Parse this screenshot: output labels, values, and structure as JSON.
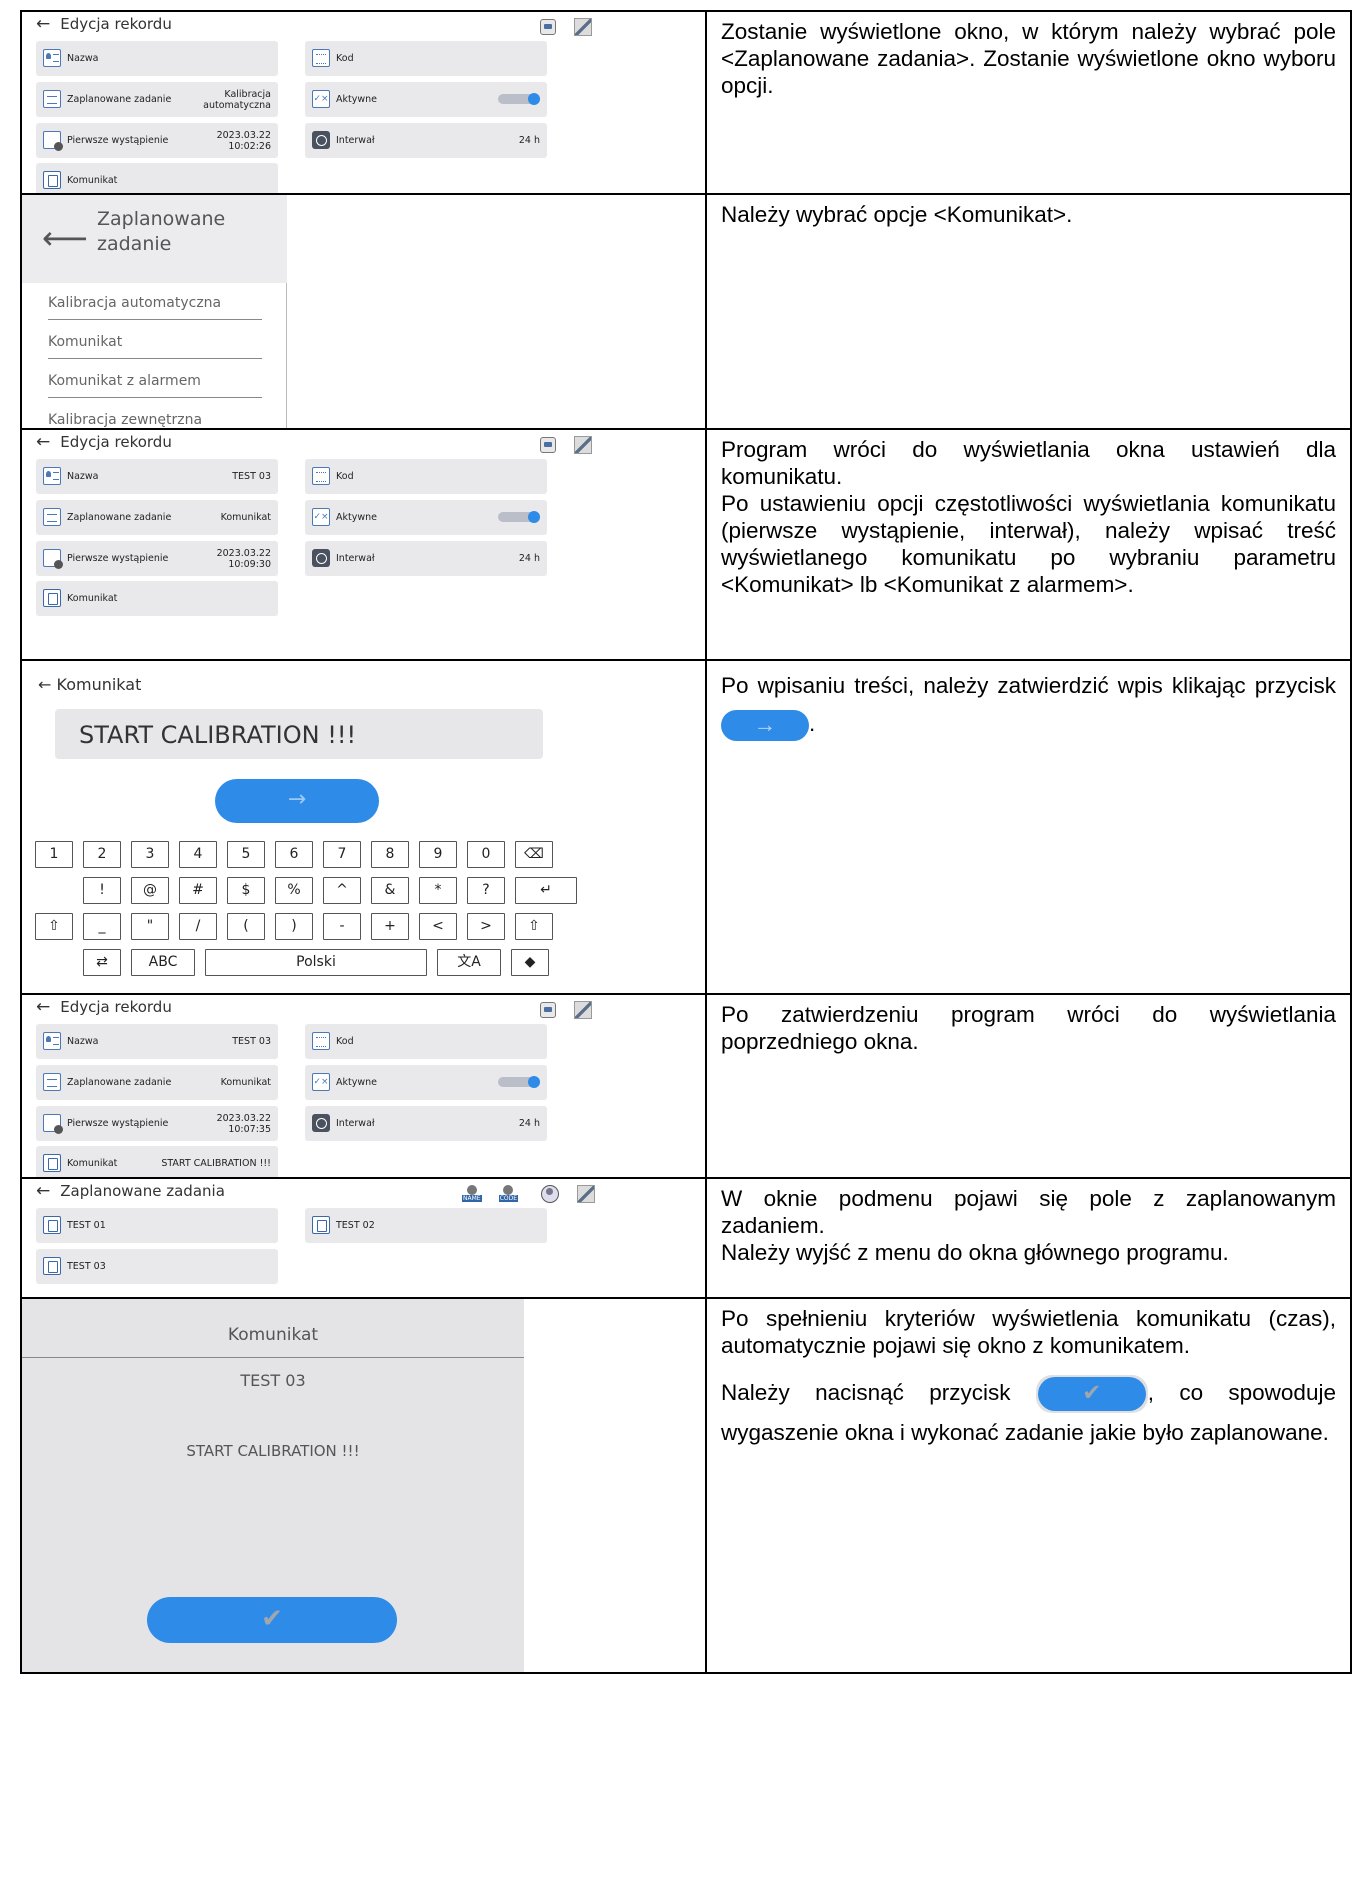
{
  "rows": [
    {
      "screen": {
        "header": "Edycja rekordu",
        "tiles": [
          {
            "label": "Nazwa",
            "value": ""
          },
          {
            "label": "Kod",
            "value": ""
          },
          {
            "label": "Zaplanowane zadanie",
            "value_l1": "Kalibracja",
            "value_l2": "automatyczna"
          },
          {
            "label": "Aktywne"
          },
          {
            "label": "Pierwsze wystąpienie",
            "value_l1": "2023.03.22",
            "value_l2": "10:02:26"
          },
          {
            "label": "Interwał",
            "value": "24 h"
          },
          {
            "label": "Komunikat",
            "value": ""
          }
        ]
      },
      "text": "Zostanie wyświetlone okno, w którym należy wybrać pole <Zaplanowane zadania>. Zostanie wyświetlone okno wyboru opcji."
    },
    {
      "screen": {
        "title_l1": "Zaplanowane",
        "title_l2": "zadanie",
        "options": [
          "Kalibracja automatyczna",
          "Komunikat",
          "Komunikat z alarmem",
          "Kalibracja zewnętrzna"
        ]
      },
      "text": "Należy wybrać opcje <Komunikat>."
    },
    {
      "screen": {
        "header": "Edycja rekordu",
        "tiles": [
          {
            "label": "Nazwa",
            "value": "TEST 03"
          },
          {
            "label": "Kod",
            "value": ""
          },
          {
            "label": "Zaplanowane zadanie",
            "value": "Komunikat"
          },
          {
            "label": "Aktywne"
          },
          {
            "label": "Pierwsze wystąpienie",
            "value_l1": "2023.03.22",
            "value_l2": "10:09:30"
          },
          {
            "label": "Interwał",
            "value": "24 h"
          },
          {
            "label": "Komunikat",
            "value": ""
          }
        ]
      },
      "text_p1": "Program wróci do wyświetlania okna ustawień dla komunikatu.",
      "text_p2": "Po ustawieniu opcji częstotliwości wyświetlania komunikatu (pierwsze wystąpienie, interwał), należy wpisać treść wyświetlanego komunikatu po wybraniu parametru <Komunikat> lb <Komunikat z alarmem>."
    },
    {
      "screen": {
        "header": "Komunikat",
        "input_value": "START CALIBRATION !!!",
        "confirm_icon": "→",
        "keys_row1": [
          "1",
          "2",
          "3",
          "4",
          "5",
          "6",
          "7",
          "8",
          "9",
          "0",
          "⌫"
        ],
        "keys_row2": [
          "!",
          "@",
          "#",
          "$",
          "%",
          "^",
          "&",
          "*",
          "?",
          "↵"
        ],
        "keys_row3": [
          "⇧",
          "_",
          "\"",
          "/",
          "(",
          ")",
          "-",
          "+",
          "<",
          ">",
          "⇧"
        ],
        "keys_row4": [
          "⇄",
          "ABC",
          "Polski",
          "文A",
          "◆"
        ]
      },
      "text_a": "Po wpisaniu treści, należy zatwierdzić wpis klikając przycisk",
      "text_b": "."
    },
    {
      "screen": {
        "header": "Edycja rekordu",
        "tiles": [
          {
            "label": "Nazwa",
            "value": "TEST 03"
          },
          {
            "label": "Kod",
            "value": ""
          },
          {
            "label": "Zaplanowane zadanie",
            "value": "Komunikat"
          },
          {
            "label": "Aktywne"
          },
          {
            "label": "Pierwsze wystąpienie",
            "value_l1": "2023.03.22",
            "value_l2": "10:07:35"
          },
          {
            "label": "Interwał",
            "value": "24 h"
          },
          {
            "label": "Komunikat",
            "value": "START CALIBRATION !!!"
          }
        ]
      },
      "text": "Po zatwierdzeniu program wróci do wyświetlania poprzedniego okna."
    },
    {
      "screen": {
        "header": "Zaplanowane zadania",
        "icon_labels": [
          "NAME",
          "CODE"
        ],
        "tiles": [
          "TEST 01",
          "TEST 02",
          "TEST 03"
        ]
      },
      "text_p1": "W oknie podmenu pojawi się pole z zaplanowanym zadaniem.",
      "text_p2": "Należy wyjść z menu do okna głównego programu."
    },
    {
      "screen": {
        "title": "Komunikat",
        "name": "TEST 03",
        "body": "START CALIBRATION !!!",
        "ok_icon": "✔"
      },
      "text_p1": "Po spełnieniu kryteriów wyświetlenia komunikatu (czas), automatycznie pojawi się okno z komunikatem.",
      "text_p2a": "Należy nacisnąć przycisk",
      "text_p2b": ", co spowoduje wygaszenie okna i wykonać zadanie jakie było zaplanowane."
    }
  ]
}
